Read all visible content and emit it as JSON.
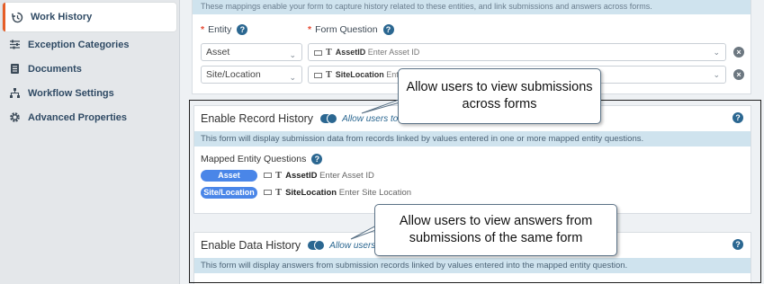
{
  "sidebar": {
    "items": [
      {
        "label": "Work History",
        "icon": "history-icon",
        "active": true
      },
      {
        "label": "Exception Categories",
        "icon": "sliders-icon"
      },
      {
        "label": "Documents",
        "icon": "document-icon"
      },
      {
        "label": "Workflow Settings",
        "icon": "workflow-icon"
      },
      {
        "label": "Advanced Properties",
        "icon": "gear-icon"
      }
    ]
  },
  "mappings": {
    "intro": "These mappings enable your form to capture history related to these entities, and link submissions and answers across forms.",
    "entity_label": "Entity",
    "question_label": "Form Question",
    "rows": [
      {
        "entity": "Asset",
        "question_name": "AssetID",
        "question_hint": "Enter Asset ID"
      },
      {
        "entity": "Site/Location",
        "question_name": "SiteLocation",
        "question_hint": "Ente"
      }
    ]
  },
  "record_history": {
    "title": "Enable Record History",
    "toggle_label": "Allow users to vie",
    "info": "This form will display submission data from records linked by values entered in one or more mapped entity questions.",
    "mapped_label": "Mapped Entity Questions",
    "items": [
      {
        "pill": "Asset",
        "question_name": "AssetID",
        "question_hint": "Enter Asset ID"
      },
      {
        "pill": "Site/Location",
        "question_name": "SiteLocation",
        "question_hint": "Enter Site Location"
      }
    ]
  },
  "data_history": {
    "title": "Enable Data History",
    "toggle_label": "Allow users to",
    "info": "This form will display answers from submission records linked by values entered into the mapped entity question."
  },
  "callouts": {
    "record": "Allow users to view submissions across forms",
    "data": "Allow users to view answers from submissions of the same form"
  },
  "colors": {
    "accent": "#2b6791",
    "pill": "#4a86e8",
    "active_marker": "#e65e28",
    "info_bg": "#cfe3ee"
  }
}
